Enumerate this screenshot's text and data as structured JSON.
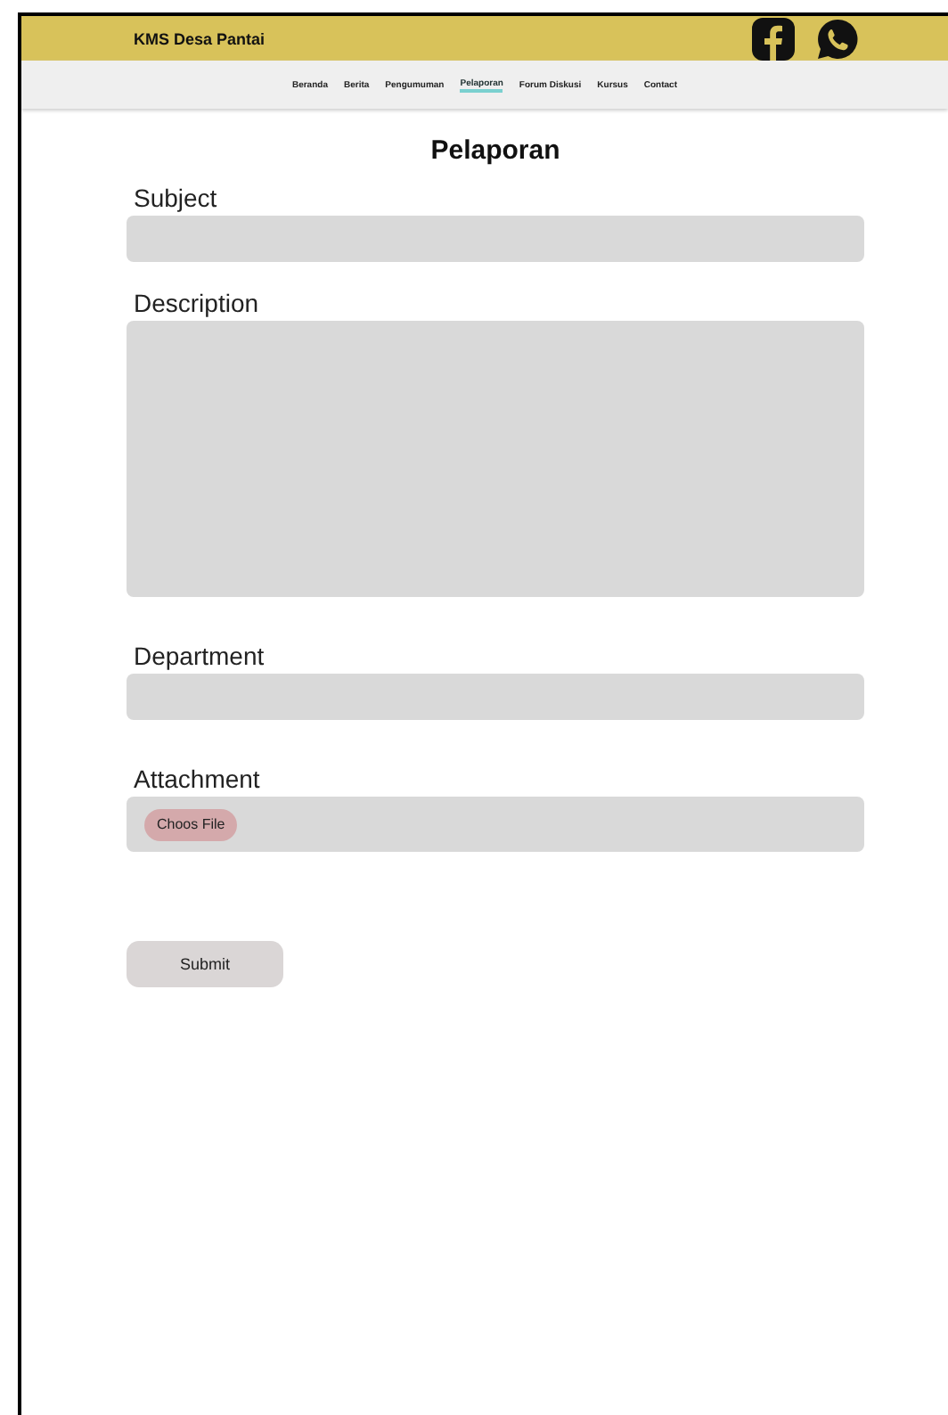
{
  "header": {
    "title": "KMS Desa Pantai"
  },
  "nav": [
    {
      "label": "Beranda",
      "selected": false
    },
    {
      "label": "Berita",
      "selected": false
    },
    {
      "label": "Pengumuman",
      "selected": false
    },
    {
      "label": "Pelaporan",
      "selected": true
    },
    {
      "label": "Forum Diskusi",
      "selected": false
    },
    {
      "label": "Kursus",
      "selected": false
    },
    {
      "label": "Contact",
      "selected": false
    }
  ],
  "page_title": "Pelaporan",
  "fields": [
    {
      "label": "Subject",
      "kind": "text"
    },
    {
      "label": "Description",
      "kind": "textarea"
    },
    {
      "label": "Department",
      "kind": "text"
    },
    {
      "label": "Attachment",
      "kind": "file",
      "button": "Choos File"
    }
  ],
  "submit": "Submit"
}
